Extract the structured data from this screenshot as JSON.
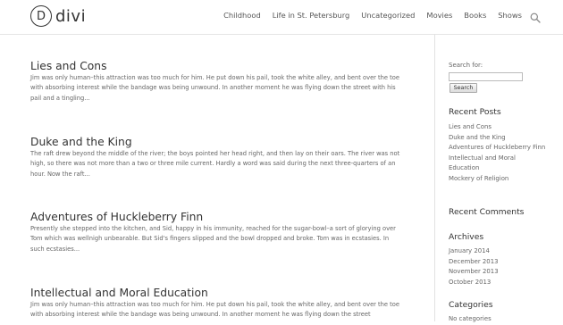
{
  "site": {
    "logo_letter": "D",
    "logo_text": "divi"
  },
  "nav": {
    "items": [
      {
        "label": "Childhood"
      },
      {
        "label": "Life in St. Petersburg"
      },
      {
        "label": "Uncategorized"
      },
      {
        "label": "Movies"
      },
      {
        "label": "Books"
      },
      {
        "label": "Shows"
      }
    ],
    "search_icon": "search-icon"
  },
  "posts": [
    {
      "title": "Lies and Cons",
      "excerpt": "Jim was only human–this attraction was too much for him. He put down his pail, took the white alley, and bent over the toe with absorbing interest while the bandage was being unwound. In another moment he was flying down the street with his pail and a tingling..."
    },
    {
      "title": "Duke and the King",
      "excerpt": "The raft drew beyond the middle of the river; the boys pointed her head right, and then lay on their oars. The river was not high, so there was not more than a two or three mile current. Hardly a word was said during the next three-quarters of an hour. Now the raft..."
    },
    {
      "title": "Adventures of Huckleberry Finn",
      "excerpt": "Presently she stepped into the kitchen, and Sid, happy in his immunity, reached for the sugar-bowl–a sort of glorying over Tom which was wellnigh unbearable. But Sid's fingers slipped and the bowl dropped and broke. Tom was in ecstasies. In such ecstasies..."
    },
    {
      "title": "Intellectual and Moral Education",
      "excerpt": "Jim was only human–this attraction was too much for him. He put down his pail, took the white alley, and bent over the toe with absorbing interest while the bandage was being unwound. In another moment he was flying down the street"
    }
  ],
  "sidebar": {
    "search": {
      "label": "Search for:",
      "value": "",
      "button": "Search"
    },
    "recent_posts": {
      "title": "Recent Posts",
      "items": [
        "Lies and Cons",
        "Duke and the King",
        "Adventures of Huckleberry Finn",
        "Intellectual and Moral Education",
        "Mockery of Religion"
      ]
    },
    "recent_comments": {
      "title": "Recent Comments"
    },
    "archives": {
      "title": "Archives",
      "items": [
        "January 2014",
        "December 2013",
        "November 2013",
        "October 2013"
      ]
    },
    "categories": {
      "title": "Categories",
      "empty": "No categories"
    }
  },
  "colors": {
    "heading": "#333333",
    "body_text": "#666666",
    "divider": "#e2e2e2"
  }
}
